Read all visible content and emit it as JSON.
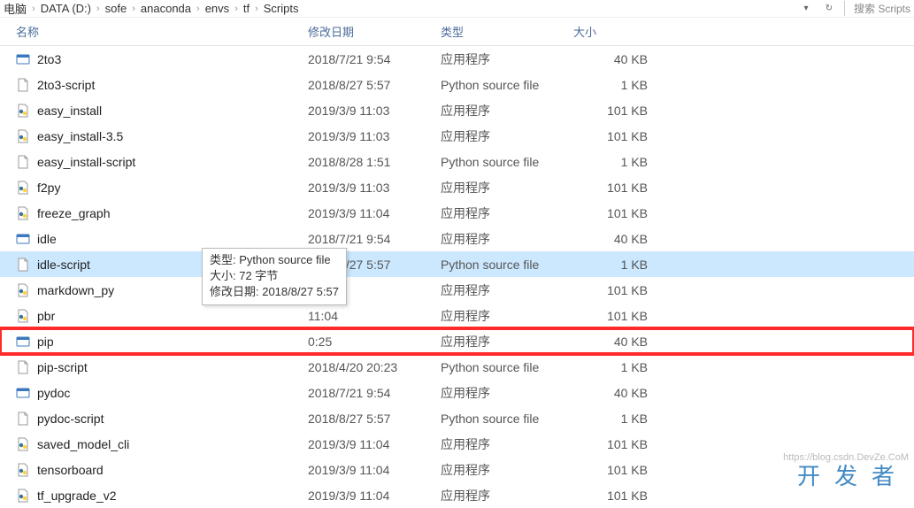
{
  "breadcrumb": {
    "segments": [
      "电脑",
      "DATA (D:)",
      "sofe",
      "anaconda",
      "envs",
      "tf",
      "Scripts"
    ]
  },
  "search": {
    "placeholder": "搜索 Scripts"
  },
  "columns": {
    "name": "名称",
    "date": "修改日期",
    "type": "类型",
    "size": "大小"
  },
  "files": [
    {
      "icon": "app-blue",
      "name": "2to3",
      "date": "2018/7/21 9:54",
      "type": "应用程序",
      "size": "40 KB"
    },
    {
      "icon": "file-blank",
      "name": "2to3-script",
      "date": "2018/8/27 5:57",
      "type": "Python source file",
      "size": "1 KB"
    },
    {
      "icon": "py",
      "name": "easy_install",
      "date": "2019/3/9 11:03",
      "type": "应用程序",
      "size": "101 KB"
    },
    {
      "icon": "py",
      "name": "easy_install-3.5",
      "date": "2019/3/9 11:03",
      "type": "应用程序",
      "size": "101 KB"
    },
    {
      "icon": "file-blank",
      "name": "easy_install-script",
      "date": "2018/8/28 1:51",
      "type": "Python source file",
      "size": "1 KB"
    },
    {
      "icon": "py",
      "name": "f2py",
      "date": "2019/3/9 11:03",
      "type": "应用程序",
      "size": "101 KB"
    },
    {
      "icon": "py",
      "name": "freeze_graph",
      "date": "2019/3/9 11:04",
      "type": "应用程序",
      "size": "101 KB"
    },
    {
      "icon": "app-blue",
      "name": "idle",
      "date": "2018/7/21 9:54",
      "type": "应用程序",
      "size": "40 KB"
    },
    {
      "icon": "file-blank",
      "name": "idle-script",
      "date": "2018/8/27 5:57",
      "type": "Python source file",
      "size": "1 KB",
      "selected": true
    },
    {
      "icon": "py",
      "name": "markdown_py",
      "date": "11:03",
      "type": "应用程序",
      "size": "101 KB"
    },
    {
      "icon": "py",
      "name": "pbr",
      "date": "11:04",
      "type": "应用程序",
      "size": "101 KB"
    },
    {
      "icon": "app-blue",
      "name": "pip",
      "date": "0:25",
      "type": "应用程序",
      "size": "40 KB",
      "highlight": true
    },
    {
      "icon": "file-blank",
      "name": "pip-script",
      "date": "2018/4/20 20:23",
      "type": "Python source file",
      "size": "1 KB"
    },
    {
      "icon": "app-blue",
      "name": "pydoc",
      "date": "2018/7/21 9:54",
      "type": "应用程序",
      "size": "40 KB"
    },
    {
      "icon": "file-blank",
      "name": "pydoc-script",
      "date": "2018/8/27 5:57",
      "type": "Python source file",
      "size": "1 KB"
    },
    {
      "icon": "py",
      "name": "saved_model_cli",
      "date": "2019/3/9 11:04",
      "type": "应用程序",
      "size": "101 KB"
    },
    {
      "icon": "py",
      "name": "tensorboard",
      "date": "2019/3/9 11:04",
      "type": "应用程序",
      "size": "101 KB"
    },
    {
      "icon": "py",
      "name": "tf_upgrade_v2",
      "date": "2019/3/9 11:04",
      "type": "应用程序",
      "size": "101 KB"
    }
  ],
  "tooltip": {
    "line1": "类型: Python source file",
    "line2": "大小: 72 字节",
    "line3": "修改日期: 2018/8/27 5:57"
  },
  "watermark": {
    "text": "开发者",
    "url": "https://blog.csdn.DevZe.CoM"
  }
}
